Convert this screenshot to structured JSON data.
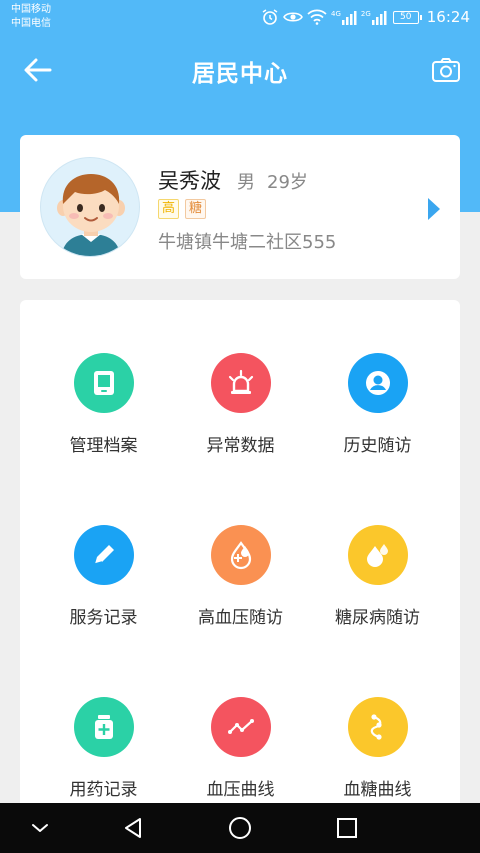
{
  "status_bar": {
    "carrier1": "中国移动",
    "carrier2": "中国电信",
    "signal1_label": "4G",
    "signal2_label": "2G",
    "battery": "50",
    "time": "16:24"
  },
  "header": {
    "title": "居民中心",
    "back_icon": "arrow-left-icon",
    "camera_icon": "camera-icon"
  },
  "profile": {
    "name": "吴秀波",
    "gender": "男",
    "age": "29岁",
    "tags": [
      "高",
      "糖"
    ],
    "address": "牛塘镇牛塘二社区555"
  },
  "grid": {
    "items": [
      {
        "label": "管理档案",
        "icon": "tablet-icon",
        "color": "#2bd1a6"
      },
      {
        "label": "异常数据",
        "icon": "alarm-light-icon",
        "color": "#f4545f"
      },
      {
        "label": "历史随访",
        "icon": "user-circle-icon",
        "color": "#1aa3f4"
      },
      {
        "label": "服务记录",
        "icon": "pencil-icon",
        "color": "#1aa3f4"
      },
      {
        "label": "高血压随访",
        "icon": "blood-drop-icon",
        "color": "#fa9152"
      },
      {
        "label": "糖尿病随访",
        "icon": "water-drops-icon",
        "color": "#fbc72b"
      },
      {
        "label": "用药记录",
        "icon": "medicine-bottle-icon",
        "color": "#2bd1a6"
      },
      {
        "label": "血压曲线",
        "icon": "line-chart-icon",
        "color": "#f4545f"
      },
      {
        "label": "血糖曲线",
        "icon": "curve-nodes-icon",
        "color": "#fbc72b"
      }
    ]
  },
  "colors": {
    "header_blue": "#52b9f8",
    "accent_blue": "#3aa6ef"
  }
}
